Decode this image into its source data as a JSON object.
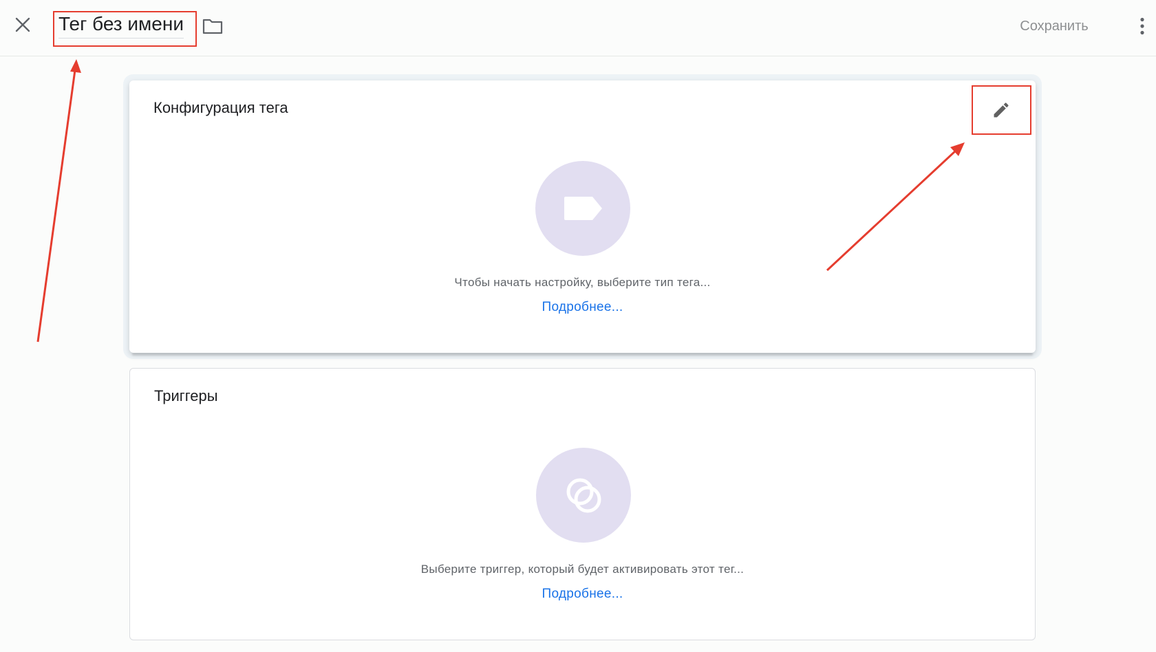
{
  "header": {
    "tag_name": "Тег без имени",
    "save_label": "Сохранить",
    "icons": [
      "close-icon",
      "folder-icon",
      "more-vert-icon"
    ]
  },
  "tag_config": {
    "title": "Конфигурация тега",
    "hint": "Чтобы начать настройку, выберите тип тега...",
    "link": "Подробнее...",
    "icons": [
      "edit-icon",
      "tag-icon"
    ]
  },
  "triggers": {
    "title": "Триггеры",
    "hint": "Выберите триггер, который будет активировать этот тег...",
    "link": "Подробнее...",
    "icons": [
      "trigger-icon"
    ]
  },
  "colors": {
    "annotation": "#e53d2f",
    "link": "#1a73e8",
    "icon_circle": "#e2def1",
    "save_text": "#8d8f91"
  }
}
